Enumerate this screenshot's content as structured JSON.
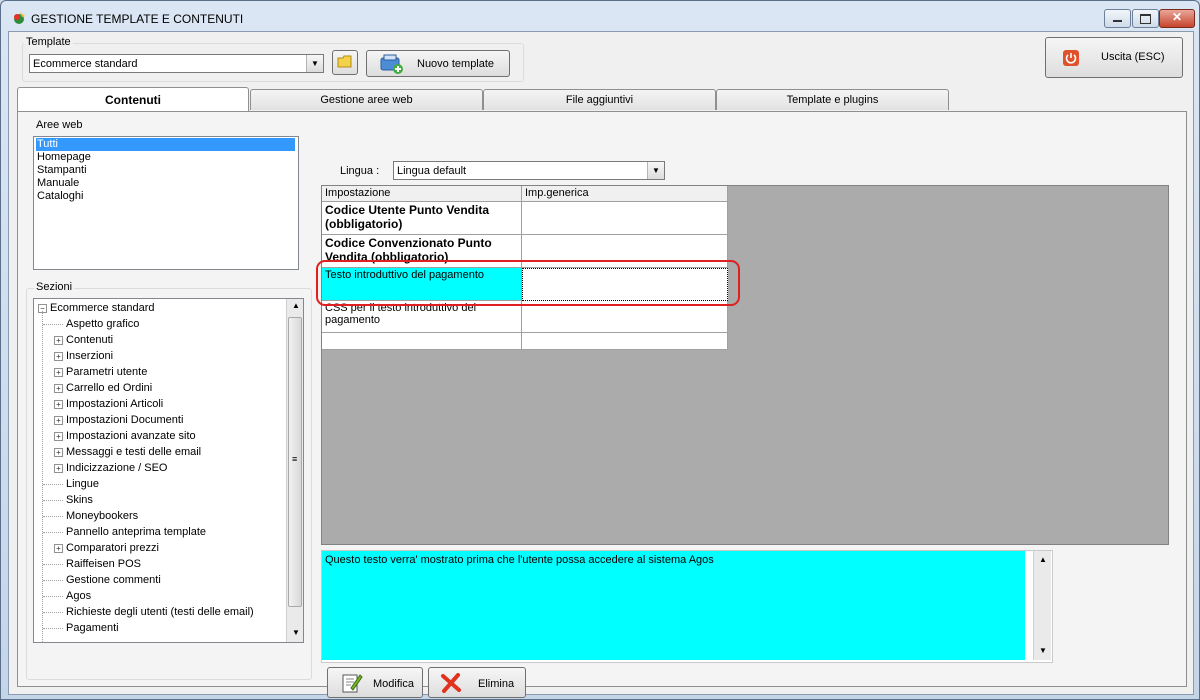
{
  "window": {
    "title": "GESTIONE TEMPLATE E CONTENUTI"
  },
  "template": {
    "group_label": "Template",
    "selected": "Ecommerce standard",
    "new_button": "Nuovo template"
  },
  "exit_button": "Uscita (ESC)",
  "tabs": [
    {
      "label": "Contenuti",
      "active": true
    },
    {
      "label": "Gestione aree web",
      "active": false
    },
    {
      "label": "File aggiuntivi",
      "active": false
    },
    {
      "label": "Template e plugins",
      "active": false
    }
  ],
  "aree_web": {
    "label": "Aree web",
    "items": [
      "Tutti",
      "Homepage",
      "Stampanti",
      "Manuale",
      "Cataloghi"
    ],
    "selected": "Tutti"
  },
  "sezioni": {
    "label": "Sezioni",
    "root": "Ecommerce standard",
    "items": [
      {
        "label": "Aspetto grafico",
        "expandable": false
      },
      {
        "label": "Contenuti",
        "expandable": true
      },
      {
        "label": "Inserzioni",
        "expandable": true
      },
      {
        "label": "Parametri utente",
        "expandable": true
      },
      {
        "label": "Carrello ed Ordini",
        "expandable": true
      },
      {
        "label": "Impostazioni Articoli",
        "expandable": true
      },
      {
        "label": "Impostazioni Documenti",
        "expandable": true
      },
      {
        "label": "Impostazioni avanzate sito",
        "expandable": true
      },
      {
        "label": "Messaggi e testi delle email",
        "expandable": true
      },
      {
        "label": "Indicizzazione / SEO",
        "expandable": true
      },
      {
        "label": "Lingue",
        "expandable": false
      },
      {
        "label": "Skins",
        "expandable": false
      },
      {
        "label": "Moneybookers",
        "expandable": false
      },
      {
        "label": "Pannello anteprima template",
        "expandable": false
      },
      {
        "label": "Comparatori prezzi",
        "expandable": true
      },
      {
        "label": "Raiffeisen POS",
        "expandable": false
      },
      {
        "label": "Gestione commenti",
        "expandable": false
      },
      {
        "label": "Agos",
        "expandable": false
      },
      {
        "label": "Richieste degli utenti (testi delle email)",
        "expandable": false
      },
      {
        "label": "Pagamenti",
        "expandable": false
      }
    ]
  },
  "lingua": {
    "label": "Lingua :",
    "selected": "Lingua default"
  },
  "grid": {
    "headers": [
      "Impostazione",
      "Imp.generica"
    ],
    "rows": [
      {
        "label": "Codice Utente Punto Vendita (obbligatorio)",
        "value": "",
        "bold": true
      },
      {
        "label": "Codice Convenzionato Punto Vendita (obbligatorio)",
        "value": "",
        "bold": true
      },
      {
        "label": "Testo introduttivo del pagamento",
        "value": "",
        "bold": false,
        "selected": true
      },
      {
        "label": "CSS per il testo introduttivo del pagamento",
        "value": "",
        "bold": false
      },
      {
        "label": "",
        "value": "",
        "bold": false
      }
    ]
  },
  "memo": {
    "text": "Questo testo verra' mostrato prima che l'utente possa accedere al sistema Agos"
  },
  "buttons": {
    "modifica": "Modifica",
    "elimina": "Elimina"
  },
  "colors": {
    "selection": "#00ffff",
    "highlight_ring": "#e02020",
    "list_selection": "#3399ff"
  }
}
